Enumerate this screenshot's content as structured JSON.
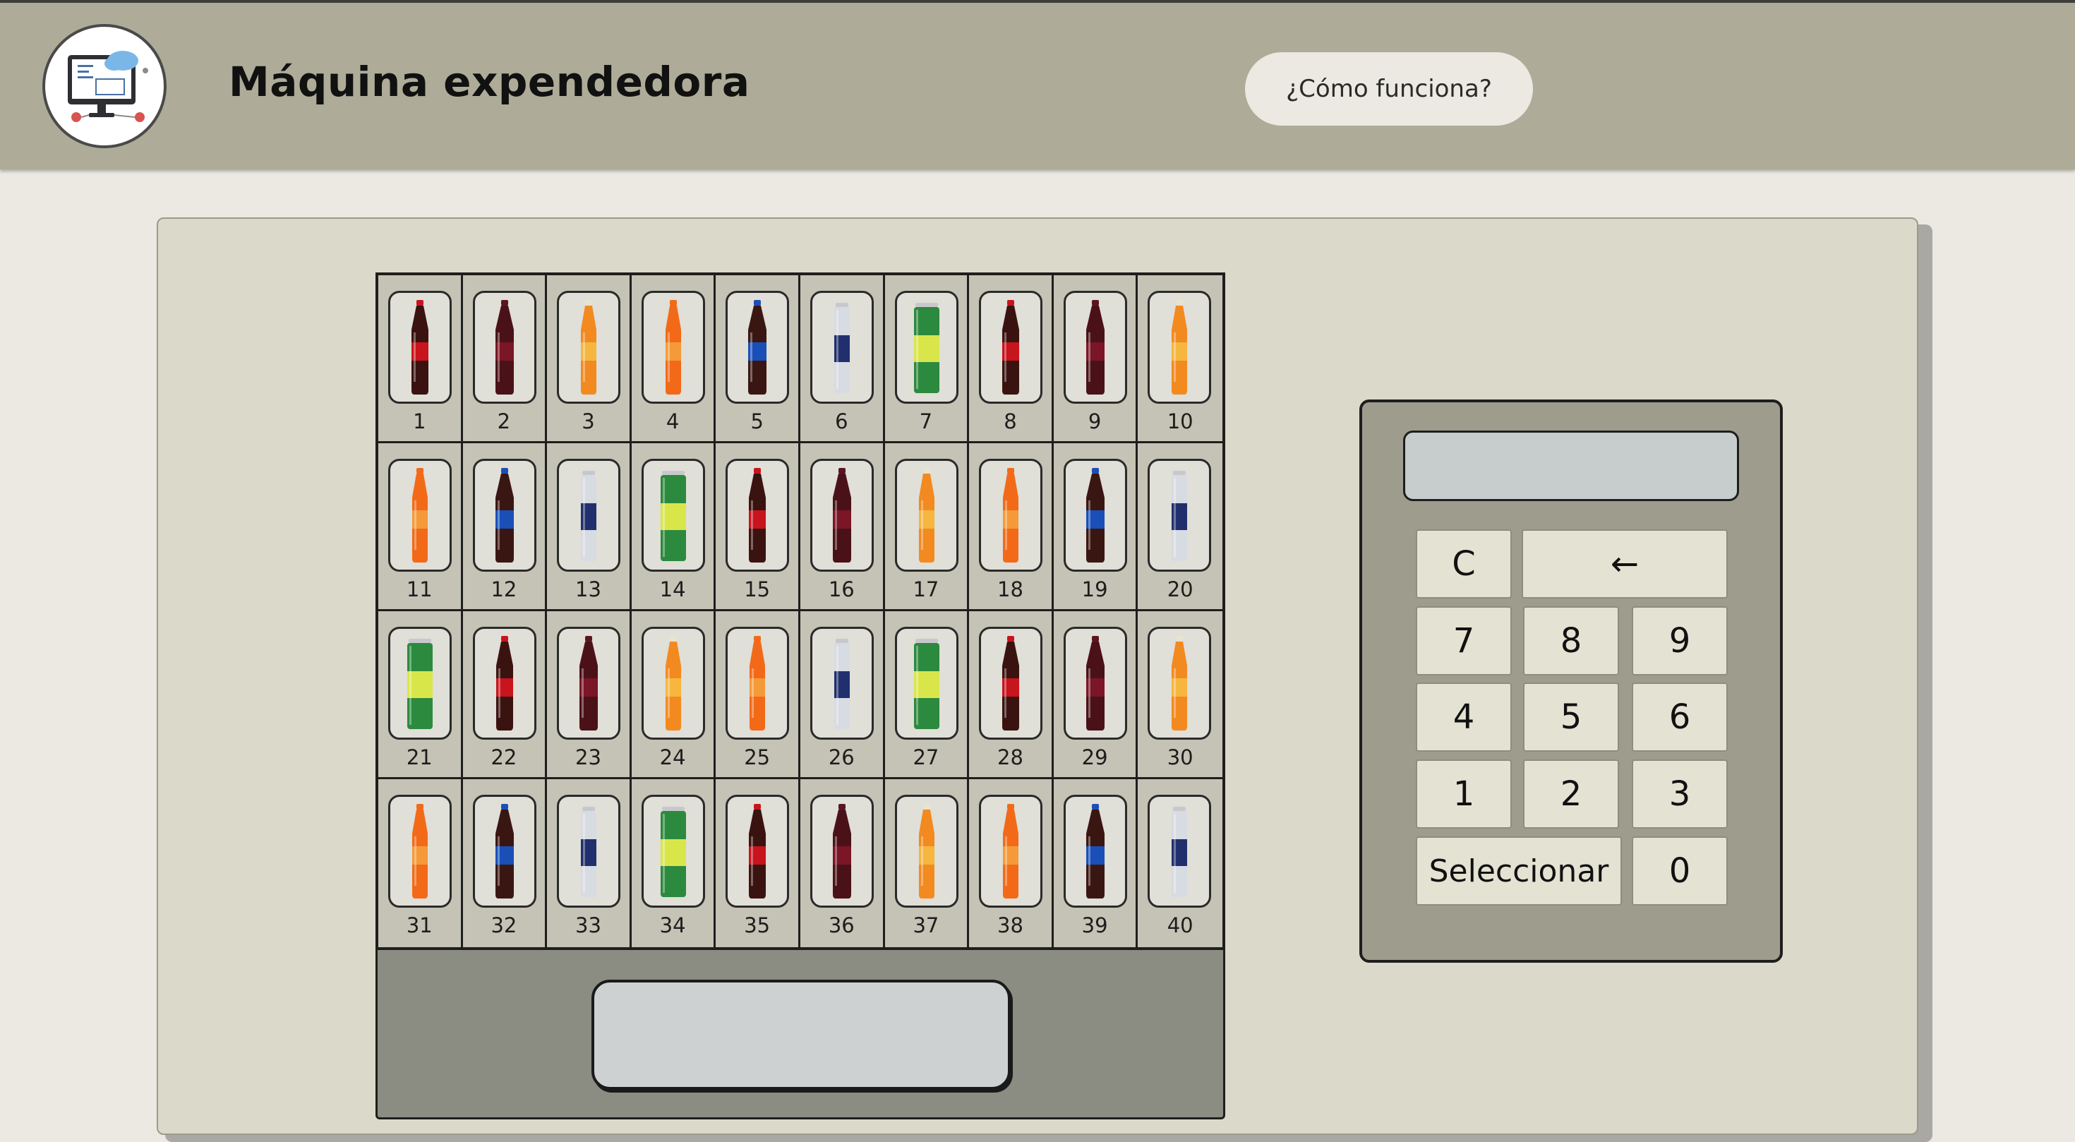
{
  "header": {
    "title": "Máquina expendedora",
    "help_button": "¿Cómo funciona?"
  },
  "colors": {
    "header_bg": "#aeac98",
    "page_bg": "#ebe9e1",
    "panel_bg": "#dbdaca",
    "keypad_bg": "#9e9d8d",
    "key_bg": "#e4e2d3",
    "display_bg": "#c7cccd",
    "dispenser_bg": "#8b8c82"
  },
  "products": [
    {
      "number": "1",
      "drink": "coca-cola"
    },
    {
      "number": "2",
      "drink": "dr-pepper"
    },
    {
      "number": "3",
      "drink": "fanta"
    },
    {
      "number": "4",
      "drink": "gatorade"
    },
    {
      "number": "5",
      "drink": "pepsi"
    },
    {
      "number": "6",
      "drink": "red-bull"
    },
    {
      "number": "7",
      "drink": "sprite"
    },
    {
      "number": "8",
      "drink": "coca-cola"
    },
    {
      "number": "9",
      "drink": "dr-pepper"
    },
    {
      "number": "10",
      "drink": "fanta"
    },
    {
      "number": "11",
      "drink": "gatorade"
    },
    {
      "number": "12",
      "drink": "pepsi"
    },
    {
      "number": "13",
      "drink": "red-bull"
    },
    {
      "number": "14",
      "drink": "sprite"
    },
    {
      "number": "15",
      "drink": "coca-cola"
    },
    {
      "number": "16",
      "drink": "dr-pepper"
    },
    {
      "number": "17",
      "drink": "fanta"
    },
    {
      "number": "18",
      "drink": "gatorade"
    },
    {
      "number": "19",
      "drink": "pepsi"
    },
    {
      "number": "20",
      "drink": "red-bull"
    },
    {
      "number": "21",
      "drink": "sprite"
    },
    {
      "number": "22",
      "drink": "coca-cola"
    },
    {
      "number": "23",
      "drink": "dr-pepper"
    },
    {
      "number": "24",
      "drink": "fanta"
    },
    {
      "number": "25",
      "drink": "gatorade"
    },
    {
      "number": "26",
      "drink": "red-bull"
    },
    {
      "number": "27",
      "drink": "sprite"
    },
    {
      "number": "28",
      "drink": "coca-cola"
    },
    {
      "number": "29",
      "drink": "dr-pepper"
    },
    {
      "number": "30",
      "drink": "fanta"
    },
    {
      "number": "31",
      "drink": "gatorade"
    },
    {
      "number": "32",
      "drink": "pepsi"
    },
    {
      "number": "33",
      "drink": "red-bull"
    },
    {
      "number": "34",
      "drink": "sprite"
    },
    {
      "number": "35",
      "drink": "coca-cola"
    },
    {
      "number": "36",
      "drink": "dr-pepper"
    },
    {
      "number": "37",
      "drink": "fanta"
    },
    {
      "number": "38",
      "drink": "gatorade"
    },
    {
      "number": "39",
      "drink": "pepsi"
    },
    {
      "number": "40",
      "drink": "red-bull"
    }
  ],
  "keypad": {
    "display_value": "",
    "keys": [
      {
        "name": "key-clear",
        "label": "C"
      },
      {
        "name": "key-backspace",
        "label": "←"
      },
      {
        "name": "key-7",
        "label": "7"
      },
      {
        "name": "key-8",
        "label": "8"
      },
      {
        "name": "key-9",
        "label": "9"
      },
      {
        "name": "key-4",
        "label": "4"
      },
      {
        "name": "key-5",
        "label": "5"
      },
      {
        "name": "key-6",
        "label": "6"
      },
      {
        "name": "key-1",
        "label": "1"
      },
      {
        "name": "key-2",
        "label": "2"
      },
      {
        "name": "key-3",
        "label": "3"
      },
      {
        "name": "select-button",
        "label": "Seleccionar"
      },
      {
        "name": "key-0",
        "label": "0"
      }
    ]
  }
}
